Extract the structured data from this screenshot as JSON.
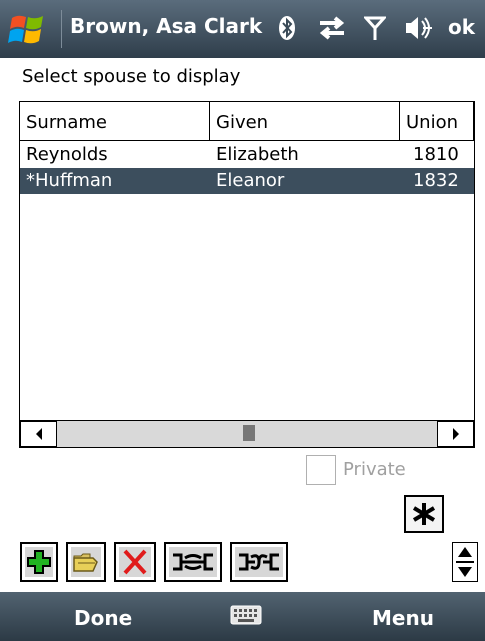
{
  "titlebar": {
    "title": "Brown, Asa Clark",
    "ok_label": "ok"
  },
  "prompt": "Select spouse to display",
  "list": {
    "columns": [
      "Surname",
      "Given",
      "Union"
    ],
    "rows": [
      {
        "surname": "Reynolds",
        "given": "Elizabeth",
        "union": "1810",
        "selected": false
      },
      {
        "surname": "*Huffman",
        "given": "Eleanor",
        "union": "1832",
        "selected": true
      }
    ]
  },
  "private_label": "Private",
  "bottombar": {
    "left": "Done",
    "right": "Menu"
  },
  "colors": {
    "selection": "#3c4e5d",
    "titlebar": "#3f4f5d",
    "add_green": "#22b322",
    "delete_red": "#e01b1b"
  },
  "icons": [
    "windows-logo-icon",
    "bluetooth-icon",
    "sync-arrows-icon",
    "signal-antenna-icon",
    "speaker-icon",
    "add-icon",
    "open-folder-icon",
    "delete-icon",
    "link-icon",
    "unlink-icon",
    "asterisk-icon",
    "keyboard-icon"
  ]
}
